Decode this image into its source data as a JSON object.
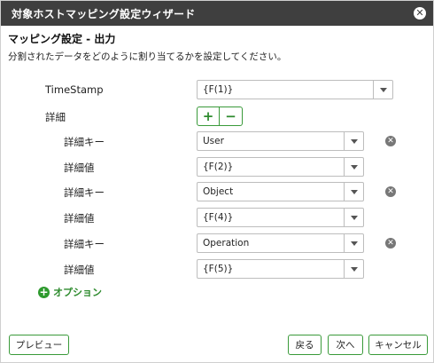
{
  "window": {
    "title": "対象ホストマッピング設定ウィザード"
  },
  "section": {
    "title": "マッピング設定 - 出力",
    "description": "分割されたデータをどのように割り当てるかを設定してください。"
  },
  "timestamp": {
    "label": "TimeStamp",
    "value": "{F(1)}"
  },
  "details": {
    "label": "詳細",
    "add_symbol": "+",
    "remove_symbol": "−",
    "rows": [
      {
        "key_label": "詳細キー",
        "key_value": "User",
        "val_label": "詳細値",
        "val_value": "{F(2)}"
      },
      {
        "key_label": "詳細キー",
        "key_value": "Object",
        "val_label": "詳細値",
        "val_value": "{F(4)}"
      },
      {
        "key_label": "詳細キー",
        "key_value": "Operation",
        "val_label": "詳細値",
        "val_value": "{F(5)}"
      }
    ]
  },
  "option": {
    "label": "オプション"
  },
  "footer": {
    "preview": "プレビュー",
    "back": "戻る",
    "next": "次へ",
    "cancel": "キャンセル"
  },
  "icons": {
    "close": "close-icon",
    "dropdown": "chevron-down-icon",
    "remove": "remove-circle-icon",
    "add": "plus-circle-icon"
  },
  "colors": {
    "titlebar": "#3f3f3f",
    "accent": "#2e8b2e"
  }
}
